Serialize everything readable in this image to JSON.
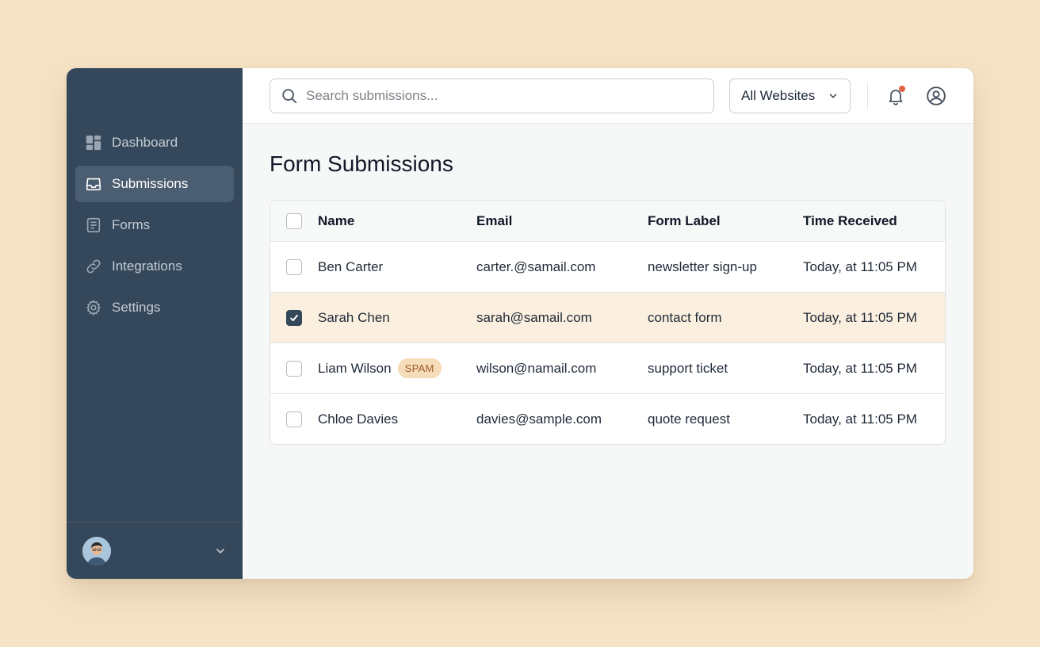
{
  "sidebar": {
    "items": [
      {
        "label": "Dashboard",
        "icon": "dashboard-icon",
        "active": false
      },
      {
        "label": "Submissions",
        "icon": "inbox-icon",
        "active": true
      },
      {
        "label": "Forms",
        "icon": "document-icon",
        "active": false
      },
      {
        "label": "Integrations",
        "icon": "link-icon",
        "active": false
      },
      {
        "label": "Settings",
        "icon": "gear-icon",
        "active": false
      }
    ]
  },
  "header": {
    "search_placeholder": "Search submissions...",
    "website_filter": "All Websites",
    "notifications_unread": true
  },
  "main": {
    "title": "Form Submissions",
    "table": {
      "columns": [
        "Name",
        "Email",
        "Form Label",
        "Time Received"
      ],
      "rows": [
        {
          "name": "Ben Carter",
          "email": "carter.@samail.com",
          "form": "newsletter sign-up",
          "time": "Today, at 11:05 PM",
          "checked": false,
          "tag": ""
        },
        {
          "name": "Sarah Chen",
          "email": "sarah@samail.com",
          "form": "contact form",
          "time": "Today, at 11:05 PM",
          "checked": true,
          "tag": ""
        },
        {
          "name": "Liam Wilson",
          "email": "wilson@namail.com",
          "form": "support ticket",
          "time": "Today, at 11:05 PM",
          "checked": false,
          "tag": "SPAM"
        },
        {
          "name": "Chloe Davies",
          "email": "davies@sample.com",
          "form": "quote request",
          "time": "Today, at 11:05 PM",
          "checked": false,
          "tag": ""
        }
      ]
    }
  },
  "colors": {
    "background": "#f6e3c6",
    "sidebar": "#35475a",
    "sidebar_active": "#4b5d70",
    "selected_row": "#fbf0df",
    "spam_badge": "#f6ddb9",
    "notification_dot": "#e0643f"
  }
}
